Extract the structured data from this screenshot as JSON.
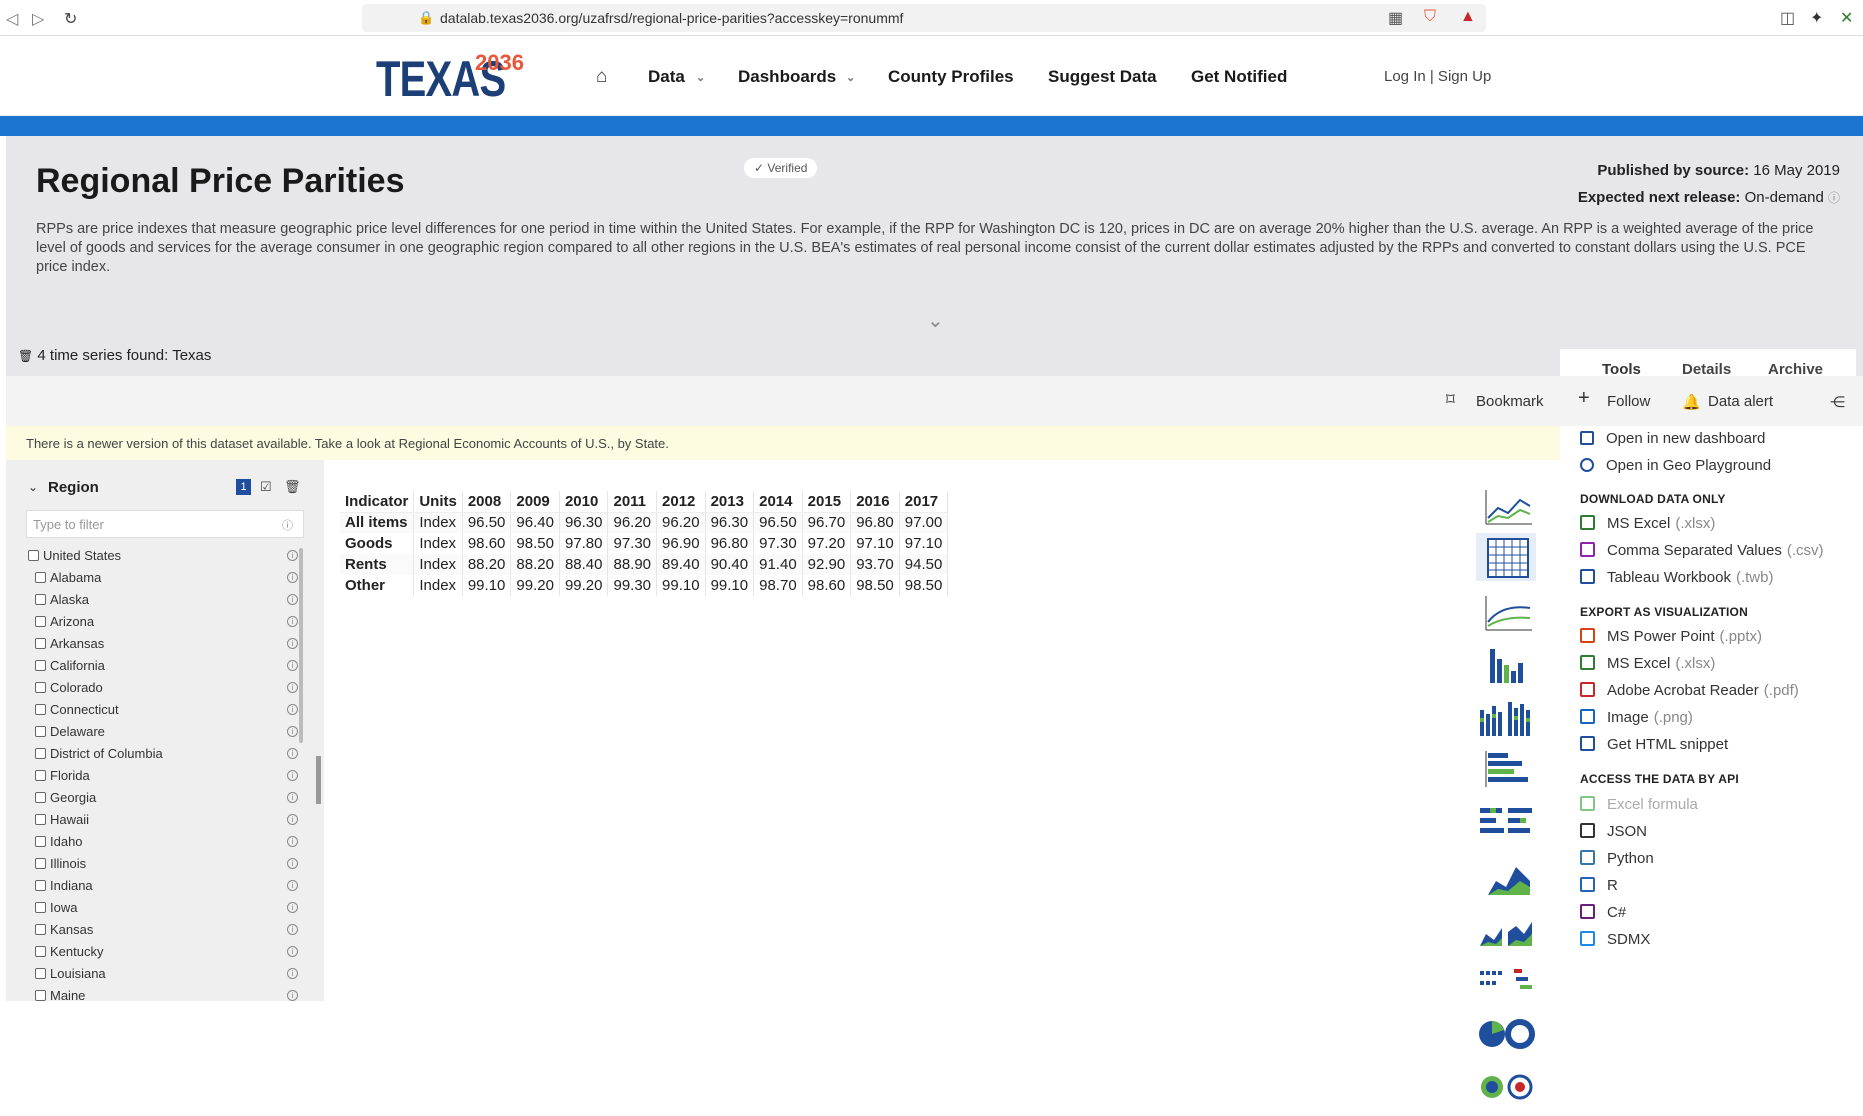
{
  "browser": {
    "url": "datalab.texas2036.org/uzafrsd/regional-price-parities?accesskey=ronummf"
  },
  "header": {
    "logo_text": "TEXAS",
    "logo_num": "2036",
    "nav": [
      "Data",
      "Dashboards",
      "County Profiles",
      "Suggest Data",
      "Get Notified"
    ],
    "login": "Log In | Sign Up"
  },
  "dataset": {
    "title": "Regional Price Parities",
    "verified": "✓ Verified",
    "published_label": "Published by source:",
    "published_value": "16 May 2019",
    "next_label": "Expected next release:",
    "next_value": "On-demand",
    "description": "RPPs are price indexes that measure geographic price level differences for one period in time within the United States. For example, if the RPP for Washington DC is 120, prices in DC are on average 20% higher than the U.S. average. An RPP is a weighted average of the price level of goods and services for the average consumer in one geographic region compared to all other regions in the U.S. BEA's estimates of real personal income consist of the current dollar estimates adjusted by the RPPs and converted to constant dollars using the U.S. PCE price index.",
    "found": "4 time series found: Texas"
  },
  "tabs": [
    "Tools",
    "Details",
    "Archive"
  ],
  "toolbar": {
    "bookmark": "Bookmark",
    "follow": "Follow",
    "alert": "Data alert"
  },
  "notice": "There is a newer version of this dataset available. Take a look at Regional Economic Accounts of U.S., by State.",
  "filter": {
    "heading": "Region",
    "badge": "1",
    "placeholder": "Type to filter",
    "regions": [
      "United States",
      "Alabama",
      "Alaska",
      "Arizona",
      "Arkansas",
      "California",
      "Colorado",
      "Connecticut",
      "Delaware",
      "District of Columbia",
      "Florida",
      "Georgia",
      "Hawaii",
      "Idaho",
      "Illinois",
      "Indiana",
      "Iowa",
      "Kansas",
      "Kentucky",
      "Louisiana",
      "Maine"
    ]
  },
  "table": {
    "headers": [
      "Indicator",
      "Units",
      "2008",
      "2009",
      "2010",
      "2011",
      "2012",
      "2013",
      "2014",
      "2015",
      "2016",
      "2017"
    ],
    "rows": [
      [
        "All items",
        "Index",
        "96.50",
        "96.40",
        "96.30",
        "96.20",
        "96.20",
        "96.30",
        "96.50",
        "96.70",
        "96.80",
        "97.00"
      ],
      [
        "Goods",
        "Index",
        "98.60",
        "98.50",
        "97.80",
        "97.30",
        "96.90",
        "96.80",
        "97.30",
        "97.20",
        "97.10",
        "97.10"
      ],
      [
        "Rents",
        "Index",
        "88.20",
        "88.20",
        "88.40",
        "88.90",
        "89.40",
        "90.40",
        "91.40",
        "92.90",
        "93.70",
        "94.50"
      ],
      [
        "Other",
        "Index",
        "99.10",
        "99.20",
        "99.20",
        "99.30",
        "99.10",
        "99.10",
        "98.70",
        "98.60",
        "98.50",
        "98.50"
      ]
    ]
  },
  "tools": {
    "open_dashboard": "Open in new dashboard",
    "open_geo": "Open in Geo Playground",
    "download_heading": "DOWNLOAD DATA ONLY",
    "downloads": [
      {
        "label": "MS Excel",
        "ext": "(.xlsx)",
        "color": "#2e7d32"
      },
      {
        "label": "Comma Separated Values",
        "ext": "(.csv)",
        "color": "#8e24aa"
      },
      {
        "label": "Tableau Workbook",
        "ext": "(.twb)",
        "color": "#1f4f9c"
      }
    ],
    "export_heading": "EXPORT AS VISUALIZATION",
    "exports": [
      {
        "label": "MS Power Point",
        "ext": "(.pptx)",
        "color": "#d84315"
      },
      {
        "label": "MS Excel",
        "ext": "(.xlsx)",
        "color": "#2e7d32"
      },
      {
        "label": "Adobe Acrobat Reader",
        "ext": "(.pdf)",
        "color": "#c62828"
      },
      {
        "label": "Image",
        "ext": "(.png)",
        "color": "#1565c0"
      },
      {
        "label": "Get HTML snippet",
        "ext": "",
        "color": "#1f4f9c"
      }
    ],
    "api_heading": "ACCESS THE DATA BY API",
    "api": [
      {
        "label": "Excel formula",
        "color": "#81c784"
      },
      {
        "label": "JSON",
        "color": "#333333"
      },
      {
        "label": "Python",
        "color": "#3776ab"
      },
      {
        "label": "R",
        "color": "#2165b6"
      },
      {
        "label": "C#",
        "color": "#68217a"
      },
      {
        "label": "SDMX",
        "color": "#1e88e5"
      }
    ]
  },
  "colors": {
    "brand_blue": "#1b75d0",
    "logo_navy": "#1d3f78",
    "logo_orange": "#e8573a"
  }
}
